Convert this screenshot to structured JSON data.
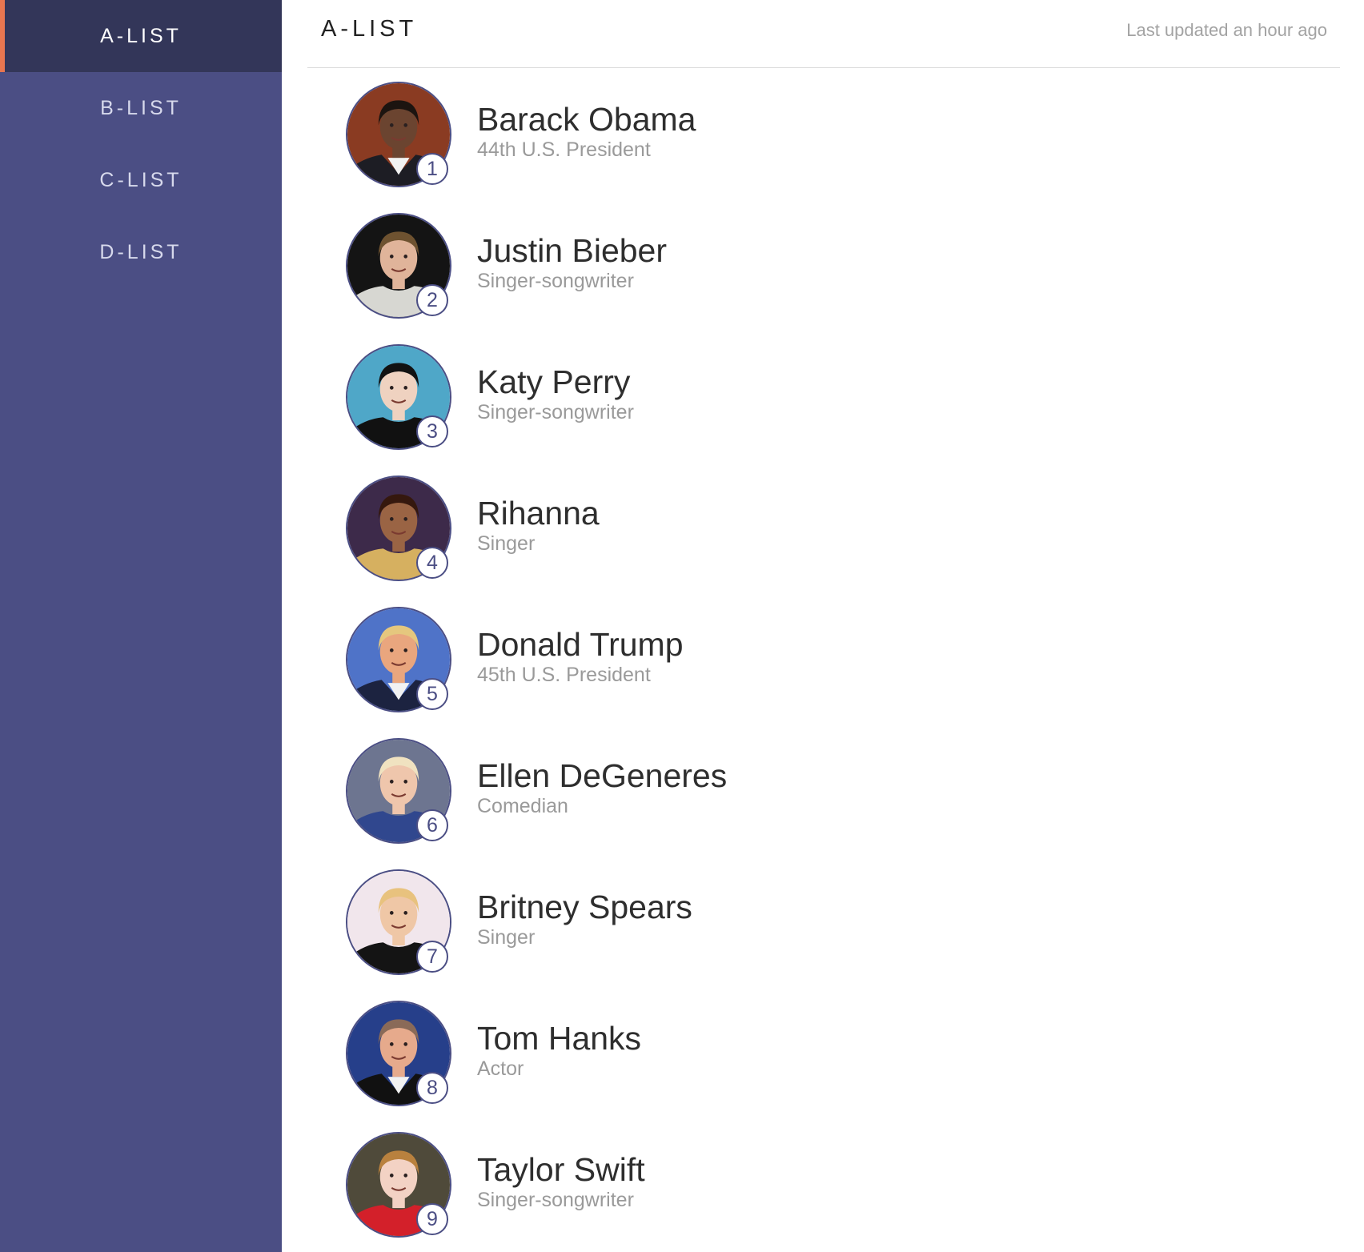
{
  "sidebar": {
    "items": [
      {
        "label": "A-LIST",
        "active": true
      },
      {
        "label": "B-LIST",
        "active": false
      },
      {
        "label": "C-LIST",
        "active": false
      },
      {
        "label": "D-LIST",
        "active": false
      }
    ]
  },
  "header": {
    "title": "A-LIST",
    "updated": "Last updated an hour ago"
  },
  "colors": {
    "sidebar_bg": "#4b4e84",
    "sidebar_active_bg": "#333659",
    "active_accent": "#e87650"
  },
  "people": [
    {
      "rank": "1",
      "name": "Barack Obama",
      "role": "44th U.S. President",
      "bg": "#8a3b22",
      "skin": "#6b4430",
      "hair": "#1c1410",
      "shirt": "#1d1d24",
      "shirt_shape": "suit"
    },
    {
      "rank": "2",
      "name": "Justin Bieber",
      "role": "Singer-songwriter",
      "bg": "#141414",
      "skin": "#e0b49a",
      "hair": "#6e5230",
      "shirt": "#d7d7d2",
      "shirt_shape": "plain"
    },
    {
      "rank": "3",
      "name": "Katy Perry",
      "role": "Singer-songwriter",
      "bg": "#4fa7c8",
      "skin": "#efd2c0",
      "hair": "#121212",
      "shirt": "#111111",
      "shirt_shape": "plain"
    },
    {
      "rank": "4",
      "name": "Rihanna",
      "role": "Singer",
      "bg": "#3d2a4a",
      "skin": "#9a6444",
      "hair": "#35180e",
      "shirt": "#d6b060",
      "shirt_shape": "plain"
    },
    {
      "rank": "5",
      "name": "Donald Trump",
      "role": "45th U.S. President",
      "bg": "#4f73c8",
      "skin": "#e9a67e",
      "hair": "#e5c77e",
      "shirt": "#1c2340",
      "shirt_shape": "suit"
    },
    {
      "rank": "6",
      "name": "Ellen DeGeneres",
      "role": "Comedian",
      "bg": "#6d7590",
      "skin": "#efc6ac",
      "hair": "#f0e2c0",
      "shirt": "#30478e",
      "shirt_shape": "plain"
    },
    {
      "rank": "7",
      "name": "Britney Spears",
      "role": "Singer",
      "bg": "#f1e6ec",
      "skin": "#efc7a6",
      "hair": "#e8c27e",
      "shirt": "#141414",
      "shirt_shape": "plain"
    },
    {
      "rank": "8",
      "name": "Tom Hanks",
      "role": "Actor",
      "bg": "#263f8a",
      "skin": "#e6aa8c",
      "hair": "#8a6a58",
      "shirt": "#111111",
      "shirt_shape": "suit"
    },
    {
      "rank": "9",
      "name": "Taylor Swift",
      "role": "Singer-songwriter",
      "bg": "#4f4a3a",
      "skin": "#f3d2c4",
      "hair": "#b9813e",
      "shirt": "#d3202a",
      "shirt_shape": "plain"
    }
  ]
}
